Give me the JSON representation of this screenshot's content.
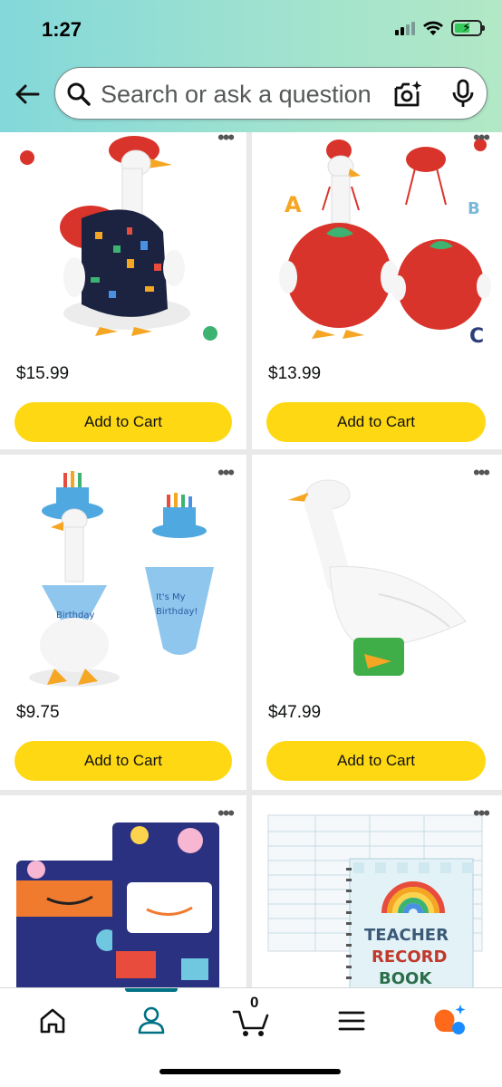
{
  "status_bar": {
    "time": "1:27"
  },
  "search": {
    "placeholder": "Search or ask a question"
  },
  "products": [
    {
      "price": "$15.99",
      "add_label": "Add to Cart"
    },
    {
      "price": "$13.99",
      "add_label": "Add to Cart"
    },
    {
      "price": "$9.75",
      "add_label": "Add to Cart"
    },
    {
      "price": "$47.99",
      "add_label": "Add to Cart"
    },
    {
      "price": "",
      "add_label": ""
    },
    {
      "price": "",
      "add_label": "",
      "image_text": [
        "TEACHER",
        "RECORD",
        "BOOK"
      ]
    }
  ],
  "more_options_glyph": "•••",
  "nav": {
    "cart_count": "0",
    "active_item": "account",
    "items": [
      "home-icon",
      "account-icon",
      "cart-icon",
      "menu-icon",
      "rufus-icon"
    ]
  },
  "colors": {
    "header_gradient_start": "#83d8da",
    "header_gradient_end": "#b2e8c5",
    "add_to_cart_button": "#ffd814",
    "active_nav": "#007185",
    "rufus_orange": "#ff6a1a",
    "rufus_blue": "#1a8cff"
  }
}
